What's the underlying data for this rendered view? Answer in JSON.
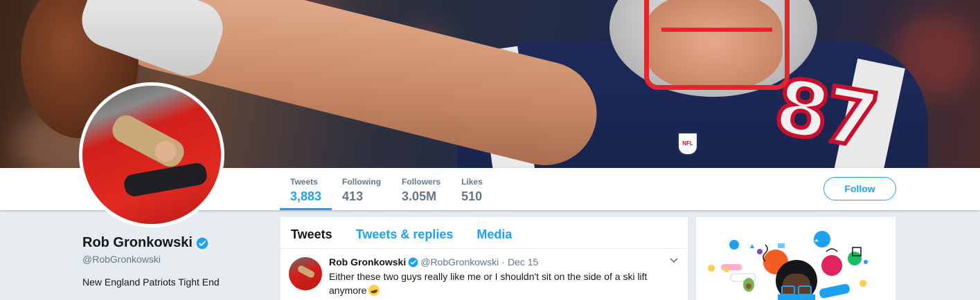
{
  "profile": {
    "name": "Rob Gronkowski",
    "handle": "@RobGronkowski",
    "bio": "New England Patriots Tight End"
  },
  "stats": [
    {
      "label": "Tweets",
      "value": "3,883",
      "active": true
    },
    {
      "label": "Following",
      "value": "413",
      "active": false
    },
    {
      "label": "Followers",
      "value": "3.05M",
      "active": false
    },
    {
      "label": "Likes",
      "value": "510",
      "active": false
    }
  ],
  "actions": {
    "follow_label": "Follow"
  },
  "tabs": [
    {
      "label": "Tweets",
      "active": true
    },
    {
      "label": "Tweets & replies",
      "active": false
    },
    {
      "label": "Media",
      "active": false
    }
  ],
  "tweet": {
    "name": "Rob Gronkowski",
    "handle": "@RobGronkowski",
    "separator": "·",
    "time": "Dec 15",
    "text": "Either these two guys really like me or I shouldn't sit on the side of a ski lift anymore"
  },
  "colors": {
    "accent": "#1da1f2",
    "background": "#e6ecf0",
    "text_secondary": "#657786"
  },
  "icons": {
    "verified": "verified-badge-icon",
    "caret": "chevron-down-icon",
    "emoji": "rolling-on-floor-laughing-emoji"
  }
}
